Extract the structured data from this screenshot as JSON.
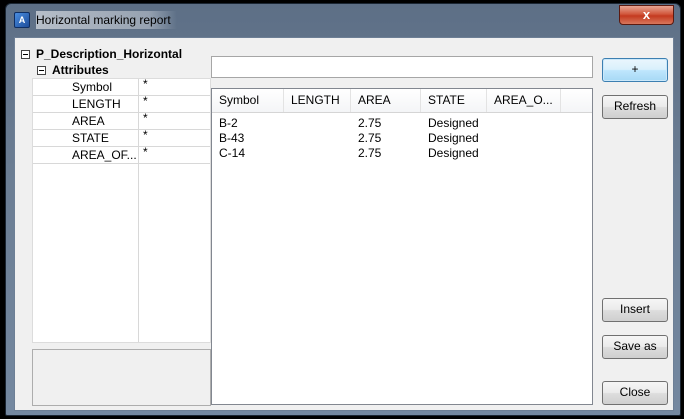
{
  "window": {
    "title": "Horizontal marking report",
    "close_label": "x",
    "app_icon_glyph": "A"
  },
  "tree": {
    "root_label": "P_Description_Horizontal",
    "group_label": "Attributes",
    "properties": [
      {
        "name": "Symbol",
        "value": "*"
      },
      {
        "name": "LENGTH",
        "value": "*"
      },
      {
        "name": "AREA",
        "value": "*"
      },
      {
        "name": "STATE",
        "value": "*"
      },
      {
        "name": "AREA_OF...",
        "value": "*"
      }
    ]
  },
  "filter": {
    "value": ""
  },
  "table": {
    "columns": [
      "Symbol",
      "LENGTH",
      "AREA",
      "STATE",
      "AREA_O..."
    ],
    "rows": [
      [
        "B-2",
        "",
        "2.75",
        "Designed"
      ],
      [
        "B-43",
        "",
        "2.75",
        "Designed"
      ],
      [
        "C-14",
        "",
        "2.75",
        "Designed"
      ]
    ]
  },
  "buttons": {
    "add": "+",
    "refresh": "Refresh",
    "insert": "Insert",
    "save_as": "Save as",
    "close": "Close"
  }
}
